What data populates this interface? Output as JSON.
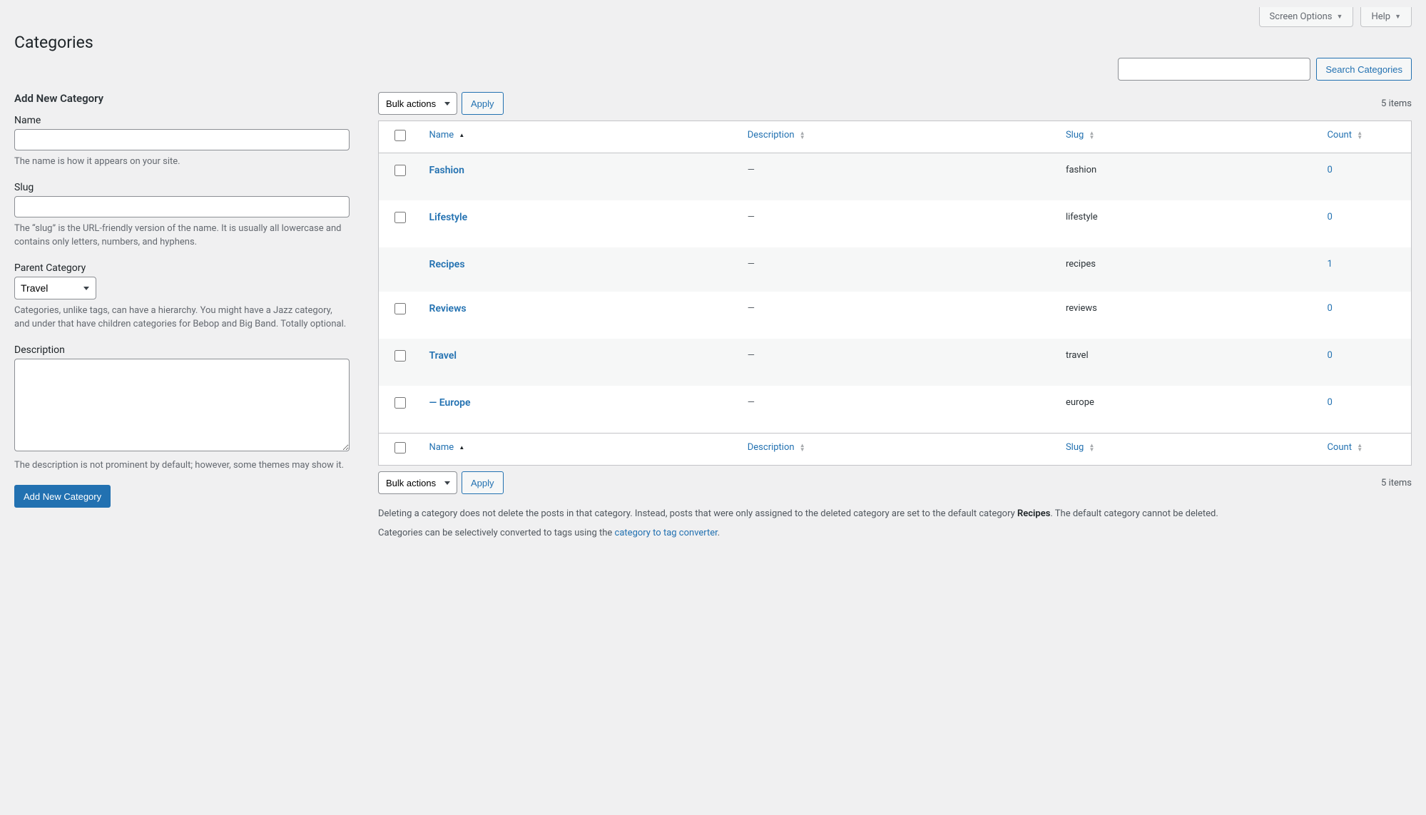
{
  "topTabs": {
    "screenOptions": "Screen Options",
    "help": "Help"
  },
  "page": {
    "title": "Categories"
  },
  "search": {
    "value": "",
    "button": "Search Categories"
  },
  "form": {
    "heading": "Add New Category",
    "name": {
      "label": "Name",
      "value": "",
      "desc": "The name is how it appears on your site."
    },
    "slug": {
      "label": "Slug",
      "value": "",
      "desc": "The “slug” is the URL-friendly version of the name. It is usually all lowercase and contains only letters, numbers, and hyphens."
    },
    "parent": {
      "label": "Parent Category",
      "selected": "Travel",
      "desc": "Categories, unlike tags, can have a hierarchy. You might have a Jazz category, and under that have children categories for Bebop and Big Band. Totally optional."
    },
    "description": {
      "label": "Description",
      "value": "",
      "desc": "The description is not prominent by default; however, some themes may show it."
    },
    "submit": "Add New Category"
  },
  "table": {
    "bulk": {
      "label": "Bulk actions",
      "apply": "Apply"
    },
    "pagination": "5 items",
    "columns": {
      "name": "Name",
      "description": "Description",
      "slug": "Slug",
      "count": "Count"
    },
    "rows": [
      {
        "name": "Fashion",
        "desc": "—",
        "slug": "fashion",
        "count": "0",
        "indent": 0
      },
      {
        "name": "Lifestyle",
        "desc": "—",
        "slug": "lifestyle",
        "count": "0",
        "indent": 0
      },
      {
        "name": "Recipes",
        "desc": "—",
        "slug": "recipes",
        "count": "1",
        "indent": 0,
        "nocb": true
      },
      {
        "name": "Reviews",
        "desc": "—",
        "slug": "reviews",
        "count": "0",
        "indent": 0
      },
      {
        "name": "Travel",
        "desc": "—",
        "slug": "travel",
        "count": "0",
        "indent": 0
      },
      {
        "name": "— Europe",
        "desc": "—",
        "slug": "europe",
        "count": "0",
        "indent": 1
      }
    ]
  },
  "footer": {
    "p1a": "Deleting a category does not delete the posts in that category. Instead, posts that were only assigned to the deleted category are set to the default category ",
    "p1strong": "Recipes",
    "p1b": ". The default category cannot be deleted.",
    "p2a": "Categories can be selectively converted to tags using the ",
    "p2link": "category to tag converter",
    "p2b": "."
  }
}
